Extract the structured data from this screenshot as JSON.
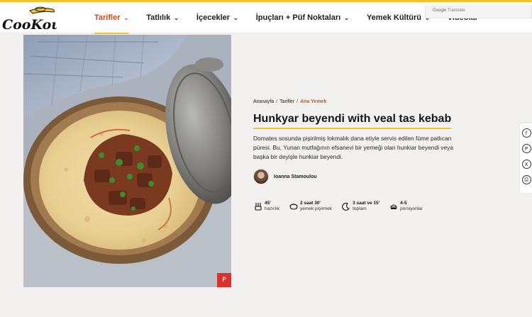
{
  "header": {
    "logo_text": "CooKout",
    "nav": [
      {
        "label": "Tarifler",
        "has_dropdown": true,
        "active": true
      },
      {
        "label": "Tatlılık",
        "has_dropdown": true,
        "active": false
      },
      {
        "label": "İçecekler",
        "has_dropdown": true,
        "active": false
      },
      {
        "label": "İpuçları + Püf Noktaları",
        "has_dropdown": true,
        "active": false
      },
      {
        "label": "Yemek Kültürü",
        "has_dropdown": true,
        "active": false
      },
      {
        "label": "Videolar",
        "has_dropdown": false,
        "active": false
      }
    ],
    "chevron": "⌄"
  },
  "translate_widget": {
    "brand": "Google",
    "label": "Translate"
  },
  "breadcrumb": {
    "items": [
      "Anasayfa",
      "Tarifler",
      "Ana Yemek"
    ],
    "separator": "/"
  },
  "recipe": {
    "title": "Hunkyar beyendi with veal tas kebab",
    "description": "Domates sosunda pişirilmiş lokmalık dana etiyle servis edilen füme patlıcan püresi. Bu, Yunan mutfağının efsanevi bir yemeği olan hunkiar beyendi veya başka bir deyişle hunkiar beyendi.",
    "author": "Ioanna Stamoulou",
    "stats": [
      {
        "value": "45'",
        "label": "hazırlık",
        "icon": "mixer-icon"
      },
      {
        "value": "2 saat 30'",
        "label": "yemek pişirmek",
        "icon": "pot-icon"
      },
      {
        "value": "3 saat ve 15'",
        "label": "toplam",
        "icon": "moon-clock-icon"
      },
      {
        "value": "4-5",
        "label": "porsiyonlar",
        "icon": "plate-icon"
      }
    ]
  },
  "image": {
    "alt": "recipe-photo",
    "pin_icon": "P"
  },
  "share": [
    {
      "icon": "facebook-icon",
      "glyph": "f"
    },
    {
      "icon": "pinterest-icon",
      "glyph": "P"
    },
    {
      "icon": "x-icon",
      "glyph": "X"
    },
    {
      "icon": "print-icon",
      "glyph": "⎙"
    }
  ],
  "colors": {
    "accent_yellow": "#f2c12e",
    "active_nav": "#c24b24",
    "breadcrumb_current": "#c25a2a",
    "pinterest_red": "#d9332b",
    "background": "#f2f1ef"
  }
}
